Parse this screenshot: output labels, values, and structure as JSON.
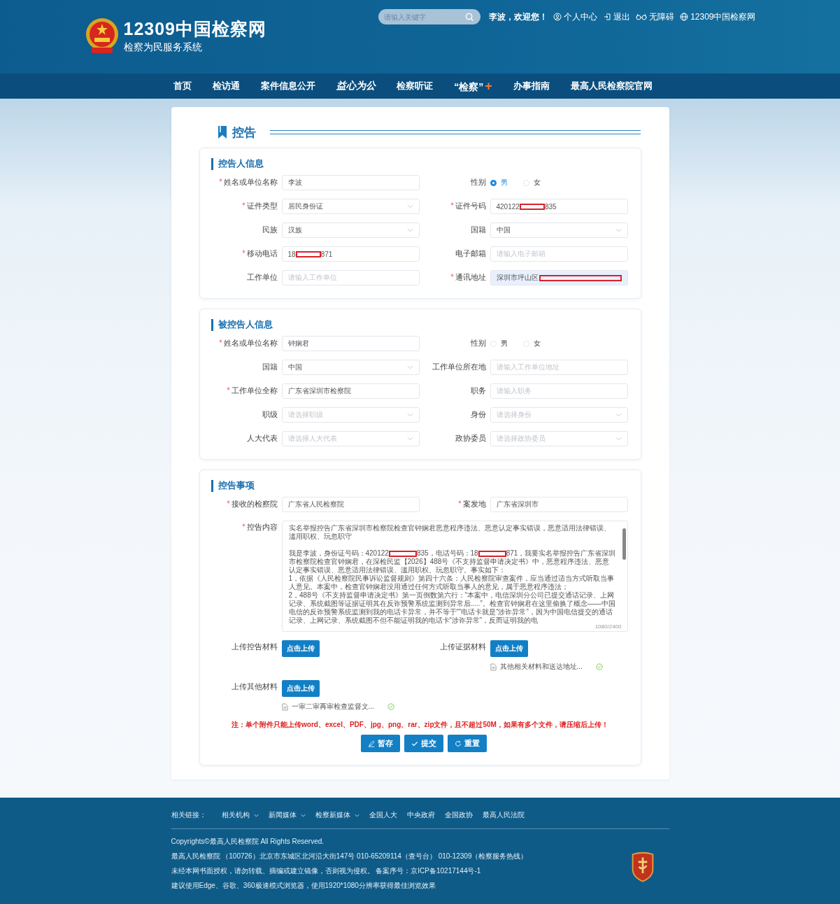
{
  "header": {
    "logo_title": "12309中国检察网",
    "logo_subtitle": "检察为民服务系统",
    "search": {
      "placeholder": "请输入关键字"
    },
    "greeting": "李波，欢迎您！",
    "links": [
      {
        "label": "个人中心"
      },
      {
        "label": "退出"
      },
      {
        "label": "无障碍"
      },
      {
        "label": "12309中国检察网"
      }
    ]
  },
  "nav": [
    {
      "kind": "text",
      "label": "首页"
    },
    {
      "kind": "text",
      "label": "检访通"
    },
    {
      "kind": "text",
      "label": "案件信息公开"
    },
    {
      "kind": "brand",
      "label": "益心为公"
    },
    {
      "kind": "text",
      "label": "检察听证"
    },
    {
      "kind": "plus",
      "label": "“检察”",
      "suffix": "+"
    },
    {
      "kind": "text",
      "label": "办事指南"
    },
    {
      "kind": "text",
      "label": "最高人民检察院官网"
    }
  ],
  "page_title": "控告",
  "sections": [
    {
      "title": "控告人信息",
      "fields": [
        {
          "kind": "input",
          "label": "姓名或单位名称",
          "required": true,
          "value": "李波"
        },
        {
          "kind": "radio",
          "label": "性别",
          "required": false,
          "options": [
            {
              "label": "男",
              "selected": true
            },
            {
              "label": "女",
              "selected": false
            }
          ]
        },
        {
          "kind": "select",
          "label": "证件类型",
          "required": true,
          "value": "居民身份证"
        },
        {
          "kind": "input",
          "label": "证件号码",
          "required": true,
          "value": "420122",
          "redacted": true,
          "value_end": "835"
        },
        {
          "kind": "select",
          "label": "民族",
          "required": false,
          "value": "汉族"
        },
        {
          "kind": "select",
          "label": "国籍",
          "required": false,
          "value": "中国"
        },
        {
          "kind": "input",
          "label": "移动电话",
          "required": true,
          "value": "18",
          "redacted": true,
          "value_end": "871"
        },
        {
          "kind": "input",
          "label": "电子邮箱",
          "required": false,
          "placeholder": "请输入电子邮箱"
        },
        {
          "kind": "input",
          "label": "工作单位",
          "required": false,
          "placeholder": "请输入工作单位"
        },
        {
          "kind": "input",
          "label": "通讯地址",
          "required": true,
          "value": "深圳市坪山区",
          "redacted": true,
          "highlighted": true
        }
      ]
    },
    {
      "title": "被控告人信息",
      "fields": [
        {
          "kind": "input",
          "label": "姓名或单位名称",
          "required": true,
          "value": "钟娴君"
        },
        {
          "kind": "radio",
          "label": "性别",
          "required": false,
          "options": [
            {
              "label": "男",
              "selected": false
            },
            {
              "label": "女",
              "selected": false
            }
          ]
        },
        {
          "kind": "select",
          "label": "国籍",
          "required": false,
          "value": "中国"
        },
        {
          "kind": "input",
          "label": "工作单位所在地",
          "required": false,
          "placeholder": "请输入工作单位地址"
        },
        {
          "kind": "input",
          "label": "工作单位全称",
          "required": true,
          "value": "广东省深圳市检察院"
        },
        {
          "kind": "input",
          "label": "职务",
          "required": false,
          "placeholder": "请输入职务"
        },
        {
          "kind": "select",
          "label": "职级",
          "required": false,
          "placeholder": "请选择职级"
        },
        {
          "kind": "select",
          "label": "身份",
          "required": false,
          "placeholder": "请选择身份"
        },
        {
          "kind": "select",
          "label": "人大代表",
          "required": false,
          "placeholder": "请选择人大代表"
        },
        {
          "kind": "select",
          "label": "政协委员",
          "required": false,
          "placeholder": "请选择政协委员"
        }
      ]
    },
    {
      "title": "控告事项",
      "fields": [
        {
          "kind": "input",
          "label": "接收的检察院",
          "required": true,
          "value": "广东省人民检察院"
        },
        {
          "kind": "input",
          "label": "案发地",
          "required": true,
          "value": "广东省深圳市"
        },
        {
          "kind": "textarea",
          "label": "控告内容",
          "required": true,
          "counter": "1080/2400",
          "paragraphs": [
            [
              {
                "kind": "text",
                "text": "实名举报控告广东省深圳市检察院检查官钟娴君恶意程序违法、恶意认定事实错误，恶意适用法律错误、滥用职权、玩忽职守"
              }
            ],
            [
              {
                "kind": "text",
                "text": "我是李波，身份证号码：420122"
              },
              {
                "kind": "redacted"
              },
              {
                "kind": "text",
                "text": "835，电话号码：18"
              },
              {
                "kind": "redacted"
              },
              {
                "kind": "text",
                "text": "871，我要实名举报控告广东省深圳市检察院检查官钟娴君，在深检民监【2026】488号《不支持监督申请决定书》中，恶意程序违法、恶意认定事实错误、恶意适用法律错误、滥用职权、玩忽职守。事实如下："
              }
            ],
            [
              {
                "kind": "text",
                "text": "1，依据《人民检察院民事诉讼监督规则》第四十六条：人民检察院审查案件，应当通过适当方式听取当事人意见。本案中，检查官钟娴君没用通过任何方式听取当事人的意见，属于恶意程序违法；"
              }
            ],
            [
              {
                "kind": "text",
                "text": "2，488号《不支持监督申请决定书》第一页倒数第六行：“本案中，电信深圳分公司已提交通话记录、上网记录、系统截图等证据证明其在反诈预警系统监测到异常后.....”。检查官钟娴君在这里偷换了概念——中国电信的反诈预警系统监测到我的电话卡异常，并不等于“”电话卡就是“涉诈异常”，因为中国电信提交的通话记录、上网记录、系统截图不但不能证明我的电话卡“涉诈异常”，反而证明我的电"
              }
            ]
          ]
        },
        {
          "kind": "upload",
          "label": "上传控告材料",
          "required": false,
          "button": "点击上传"
        },
        {
          "kind": "upload",
          "label": "上传证据材料",
          "required": false,
          "button": "点击上传",
          "files": [
            {
              "name": "其他相关材料和送达地址..."
            }
          ]
        },
        {
          "kind": "upload",
          "label": "上传其他材料",
          "required": false,
          "button": "点击上传",
          "files": [
            {
              "name": "一审二审再审检查监督文..."
            }
          ]
        }
      ],
      "note": "注：单个附件只能上传word、excel、PDF、jpg、png、rar、zip文件，且不超过50M，如果有多个文件，请压缩后上传！",
      "actions": [
        {
          "label": "暂存"
        },
        {
          "label": "提交"
        },
        {
          "label": "重置"
        }
      ]
    }
  ],
  "footer": {
    "links_label": "相关链接：",
    "links": [
      {
        "label": "相关机构",
        "dropdown": true
      },
      {
        "label": "新闻媒体",
        "dropdown": true
      },
      {
        "label": "检察新媒体",
        "dropdown": true
      },
      {
        "label": "全国人大",
        "dropdown": false
      },
      {
        "label": "中央政府",
        "dropdown": false
      },
      {
        "label": "全国政协",
        "dropdown": false
      },
      {
        "label": "最高人民法院",
        "dropdown": false
      }
    ],
    "lines": [
      "Copyrights©最高人民检察院 All Rights Reserved.",
      "最高人民检察院 （100726）北京市东城区北河沿大街147号 010-65209114（查号台） 010-12309（检察服务热线）",
      "未经本网书面授权，请勿转载、摘编或建立镜像，否则视为侵权。 备案序号：京ICP备10217144号-1",
      "建议使用Edge、谷歌、360极速模式浏览器，使用1920*1080分辨率获得最佳浏览效果"
    ]
  }
}
